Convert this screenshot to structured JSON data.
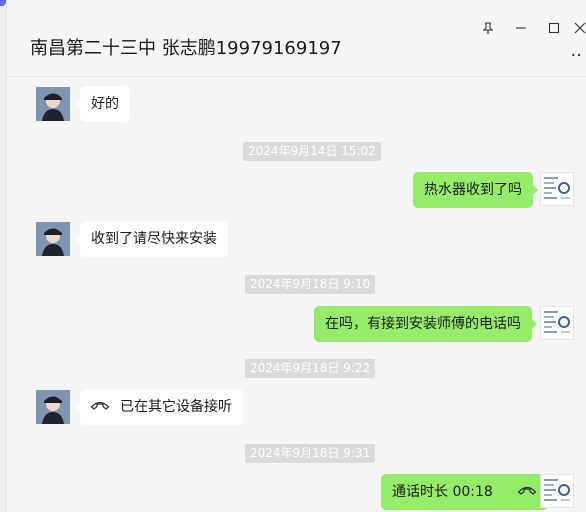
{
  "header": {
    "title": "南昌第二十三中 张志鹏19979169197",
    "window_controls": [
      "pin-icon",
      "minimize-icon",
      "maximize-icon",
      "close-icon"
    ],
    "more": "more-icon"
  },
  "messages": [
    {
      "type": "text",
      "side": "in",
      "text": "好的"
    },
    {
      "type": "timestamp",
      "text": "2024年9月14日 15:02"
    },
    {
      "type": "text",
      "side": "out",
      "text": "热水器收到了吗"
    },
    {
      "type": "text",
      "side": "in",
      "text": "收到了请尽快来安装"
    },
    {
      "type": "timestamp",
      "text": "2024年9月18日 9:10"
    },
    {
      "type": "text",
      "side": "out",
      "text": "在吗，有接到安装师傅的电话吗"
    },
    {
      "type": "timestamp",
      "text": "2024年9月18日 9:22"
    },
    {
      "type": "call",
      "side": "in",
      "text": "已在其它设备接听",
      "icon": "phone-icon"
    },
    {
      "type": "timestamp",
      "text": "2024年9月18日 9:31"
    },
    {
      "type": "call",
      "side": "out",
      "text": "通话时长 00:18",
      "icon": "phone-icon"
    }
  ],
  "colors": {
    "outgoing_bubble": "#95ec69",
    "incoming_bubble": "#ffffff",
    "background": "#f5f5f5",
    "timestamp_bg": "#dadada",
    "sidebar_accent": "#5b6cf0"
  }
}
